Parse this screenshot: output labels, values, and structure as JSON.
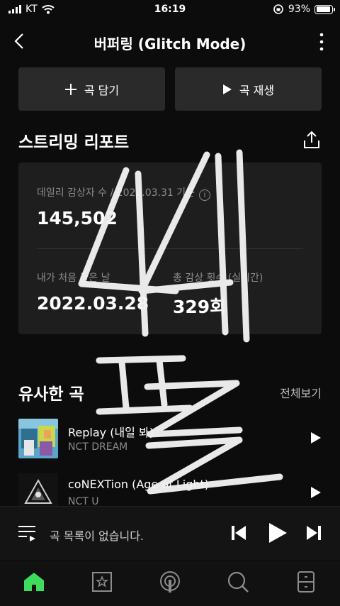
{
  "status_bar": {
    "carrier": "KT",
    "time": "16:19",
    "battery": "93%",
    "battery_level": 0.93
  },
  "header": {
    "title": "버퍼링 (Glitch Mode)"
  },
  "actions": {
    "add_label": "곡 담기",
    "play_label": "곡 재생"
  },
  "report": {
    "title": "스트리밍 리포트",
    "daily_label": "데일리 감상자 수 / 2022.03.31 기준",
    "daily_value": "145,502",
    "first_label": "내가 처음 들은 날",
    "first_value": "2022.03.28",
    "total_label": "총 감상 횟수 (실시간)",
    "total_value": "329회"
  },
  "similar": {
    "title": "유사한 곡",
    "see_all": "전체보기",
    "tracks": [
      {
        "title": "Replay (내일 봐)",
        "artist": "NCT DREAM"
      },
      {
        "title": "coNEXTion (Age of Light)",
        "artist": "NCT U"
      }
    ]
  },
  "player": {
    "message": "곡 목록이 없습니다."
  },
  "tabs": [
    "home-icon",
    "library-icon",
    "podcast-icon",
    "search-icon",
    "storage-icon"
  ],
  "colors": {
    "accent": "#3ddc5c",
    "background": "#0c0c0c",
    "card": "#1e1e1e"
  }
}
